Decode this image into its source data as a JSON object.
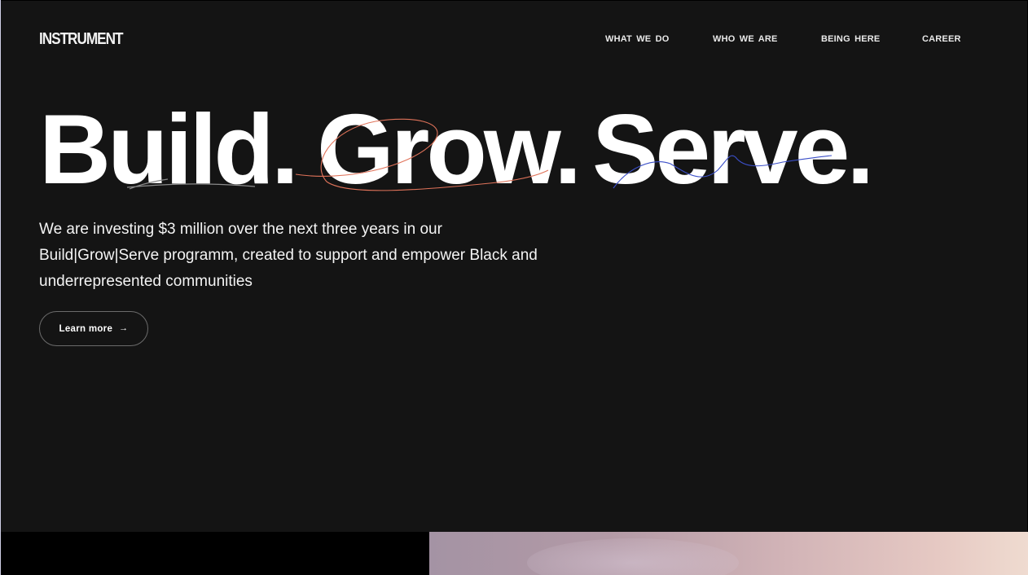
{
  "header": {
    "logo": "INSTRUMENT",
    "nav": [
      {
        "label": "WHAT WE DO"
      },
      {
        "label": "WHO WE ARE"
      },
      {
        "label": "BEING HERE"
      },
      {
        "label": "CAREER"
      }
    ]
  },
  "hero": {
    "headline": [
      "Build.",
      "Grow.",
      "Serve."
    ],
    "intro": "We are investing $3 million over the next three years in our Build|Grow|Serve programm, created to support and empower Black and underrepresented communities",
    "cta_label": "Learn more",
    "cta_icon": "arrow-right-icon"
  },
  "colors": {
    "background": "#141414",
    "text": "#ffffff",
    "scribble_build": "#8a8a8a",
    "scribble_grow": "#e0735a",
    "scribble_serve": "#3b4fc8",
    "footer_image_start": "#a493a4",
    "footer_image_end": "#efdbd0"
  }
}
